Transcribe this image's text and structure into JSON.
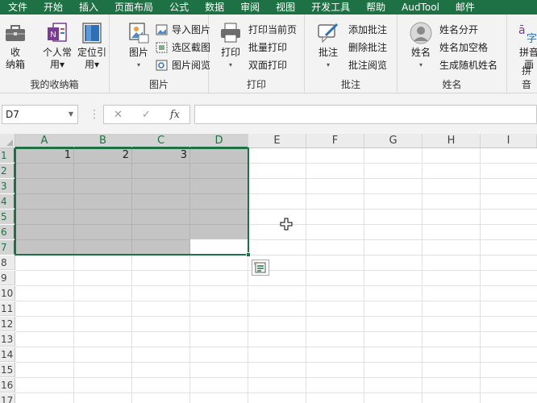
{
  "menu": [
    "文件",
    "开始",
    "插入",
    "页面布局",
    "公式",
    "数据",
    "审阅",
    "视图",
    "开发工具",
    "帮助",
    "AudTool",
    "邮件"
  ],
  "ribbon": {
    "groups": {
      "my_box": {
        "label": "我的收纳箱",
        "btn_box": "收\n纳箱",
        "btn_personal": "个人常\n用▾",
        "btn_locate": "定位引\n用▾"
      },
      "picture": {
        "label": "图片",
        "btn_picture": "图片",
        "import": "导入图片",
        "capture": "选区截图",
        "browse": "图片阅览"
      },
      "print": {
        "label": "打印",
        "btn_print": "打印",
        "current_page": "打印当前页",
        "batch": "批量打印",
        "duplex": "双面打印"
      },
      "comment": {
        "label": "批注",
        "btn_comment": "批注",
        "add": "添加批注",
        "delete": "删除批注",
        "browse": "批注阅览"
      },
      "name": {
        "label": "姓名",
        "btn_name": "姓名",
        "split": "姓名分开",
        "add_space": "姓名加空格",
        "random": "生成随机姓名"
      },
      "pinyin": {
        "label": "拼音",
        "btn_pinyin": "拼音\n画"
      }
    }
  },
  "formula_bar": {
    "name_box": "D7",
    "cancel": "✕",
    "enter": "✓",
    "fx": "fx",
    "value": ""
  },
  "sheet": {
    "columns": [
      "A",
      "B",
      "C",
      "D",
      "E",
      "F",
      "G",
      "H",
      "I"
    ],
    "selected_columns": [
      "A",
      "B",
      "C",
      "D"
    ],
    "rows": [
      "1",
      "2",
      "3",
      "4",
      "5",
      "6",
      "7",
      "8",
      "9",
      "10",
      "11",
      "12",
      "13",
      "14",
      "15",
      "16",
      "17"
    ],
    "selected_rows": [
      "1",
      "2",
      "3",
      "4",
      "5",
      "6",
      "7"
    ],
    "cells": {
      "A1": "1",
      "B1": "2",
      "C1": "3"
    },
    "active_cell": "D7",
    "selection": "A1:D7"
  },
  "colors": {
    "accent": "#1e7145",
    "selection_fill": "#c4c4c4"
  }
}
